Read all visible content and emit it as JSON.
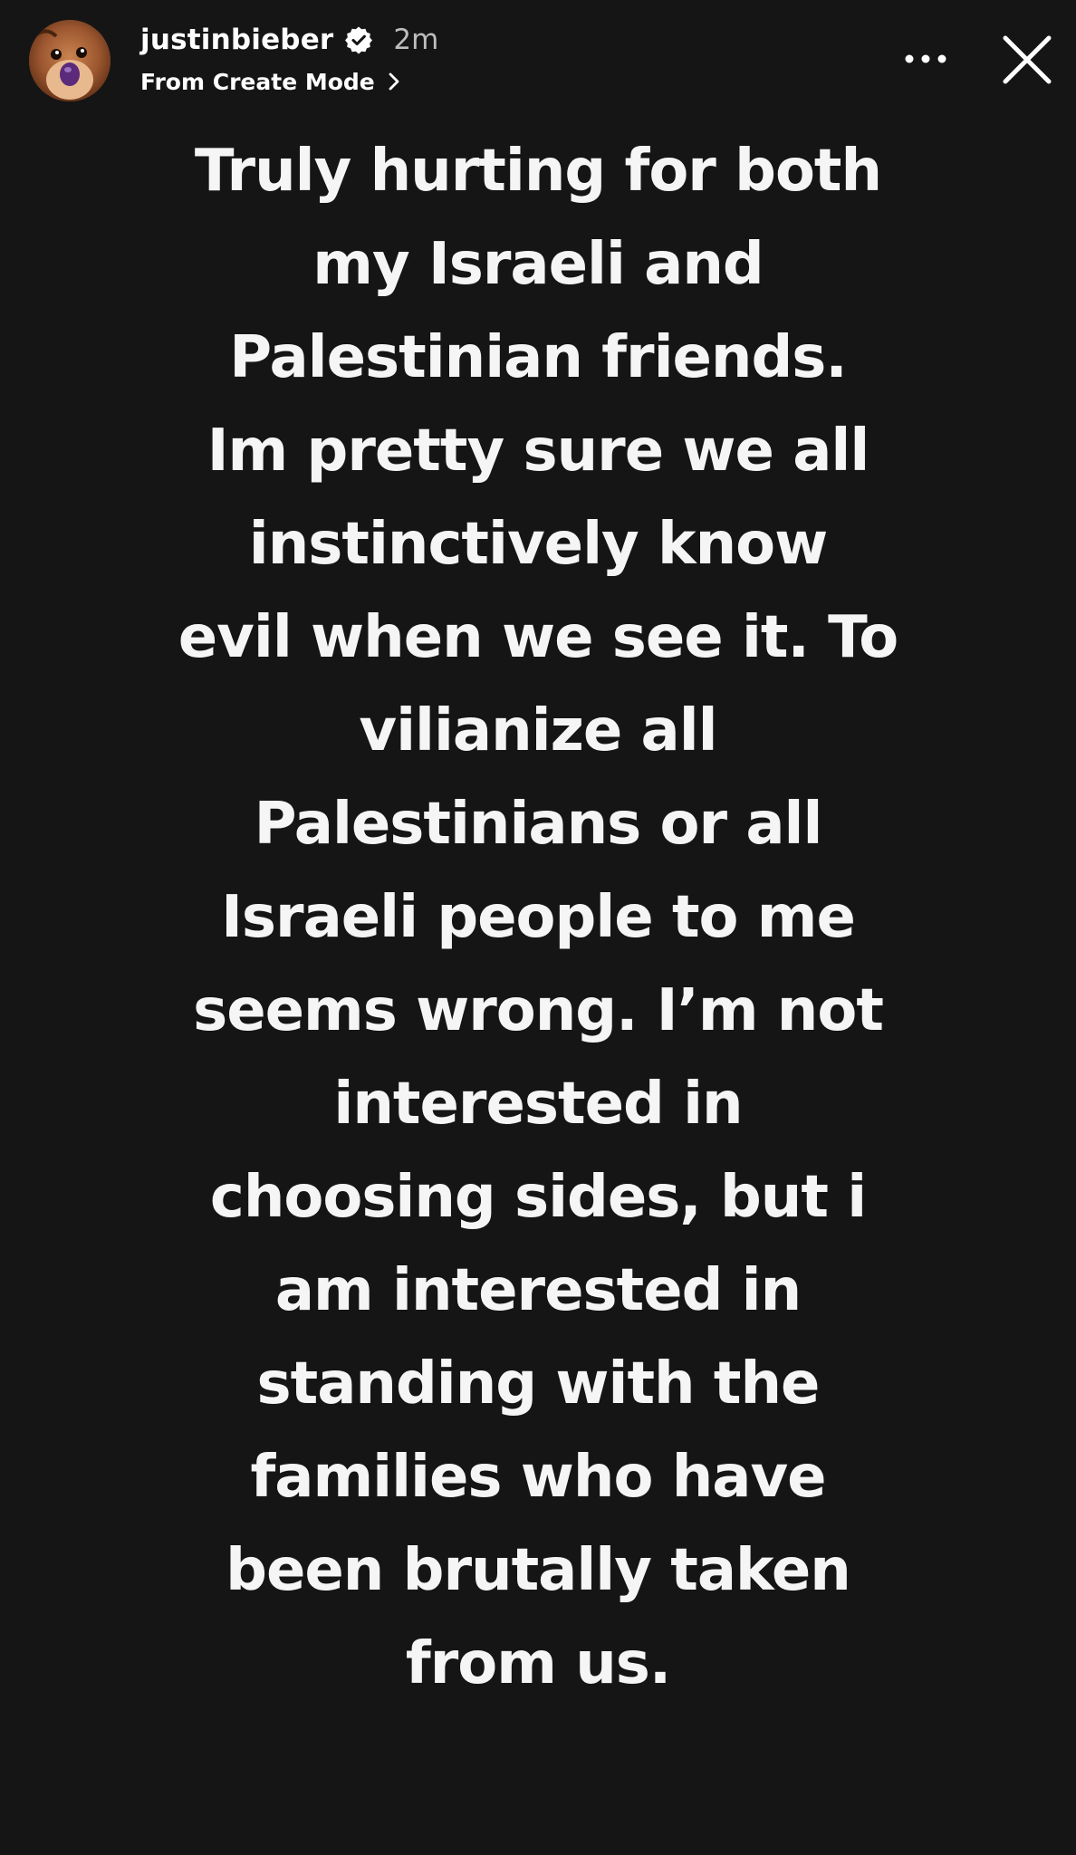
{
  "story": {
    "username": "justinbieber",
    "verified_icon": "verified-badge-icon",
    "time_ago": "2m",
    "source": "From Create Mode",
    "more_icon": "more-horizontal-icon",
    "close_icon": "close-icon",
    "text_lines": [
      "Truly hurting for both",
      "my Israeli and",
      "Palestinian friends.",
      "Im pretty sure we all",
      "instinctively know",
      "evil when we see it. To",
      "vilianize all",
      "Palestinians or all",
      "Israeli people to me",
      "seems wrong. I’m not",
      "interested in",
      "choosing sides, but i",
      "am interested in",
      "standing with the",
      "families who have",
      "been brutally taken",
      "from us."
    ]
  },
  "colors": {
    "background": "#151515",
    "text": "#f5f5f5",
    "muted": "#bdbdbd"
  }
}
